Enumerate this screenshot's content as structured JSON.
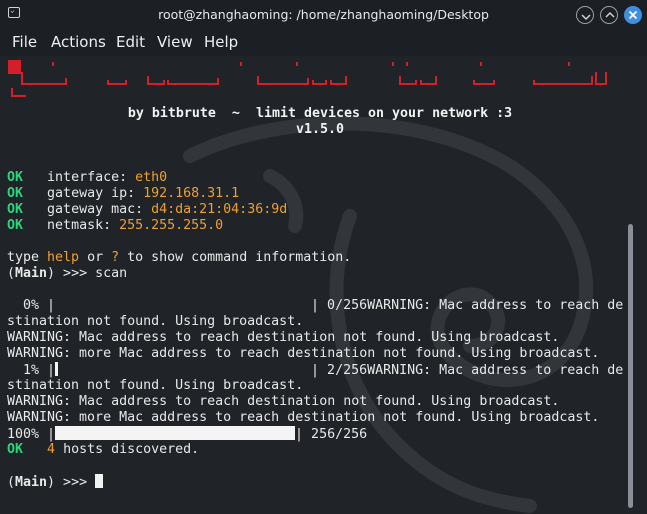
{
  "window": {
    "title": "root@zhanghaoming: /home/zhanghaoming/Desktop"
  },
  "menu": {
    "file": "File",
    "actions": "Actions",
    "edit": "Edit",
    "view": "View",
    "help": "Help"
  },
  "banner": {
    "credit": "by bitbrute  ~  limit devices on your network :3",
    "version": "v1.5.0"
  },
  "status": {
    "ok": "OK",
    "interface_label": "interface: ",
    "interface_value": "eth0",
    "gateway_ip_label": "gateway ip: ",
    "gateway_ip_value": "192.168.31.1",
    "gateway_mac_label": "gateway mac: ",
    "gateway_mac_value": "d4:da:21:04:36:9d",
    "netmask_label": "netmask: ",
    "netmask_value": "255.255.255.0"
  },
  "help_line": {
    "prefix": "type ",
    "help": "help",
    "or": " or ",
    "question": "?",
    "suffix": " to show command information."
  },
  "prompt": {
    "main": "Main",
    "open": "(",
    "close": ") >>> ",
    "command": "scan"
  },
  "scan_output": {
    "progress0_pct": "  0% |",
    "progress0_rest": "| 0/256WARNING: Mac address to reach de",
    "wrap1": "stination not found. Using broadcast.",
    "warn1": "WARNING: Mac address to reach destination not found. Using broadcast.",
    "warn_more1": "WARNING: more Mac address to reach destination not found. Using broadcast.",
    "progress1_pct": "  1% |",
    "progress1_rest": "| 2/256WARNING: Mac address to reach de",
    "wrap2": "stination not found. Using broadcast.",
    "warn2": "WARNING: Mac address to reach destination not found. Using broadcast.",
    "warn_more2": "WARNING: more Mac address to reach destination not found. Using broadcast.",
    "progress100_pct": "100% |",
    "progress100_rest": "| 256/256",
    "hosts_count": "4",
    "hosts_text": " hosts discovered."
  },
  "progress": {
    "first": 0,
    "second": 0.01,
    "final": 1.0
  },
  "colors": {
    "ok_green": "#2ed47a",
    "value_orange": "#f0a030",
    "banner_red": "#d1202a",
    "close_blue": "#3f8fe0"
  }
}
